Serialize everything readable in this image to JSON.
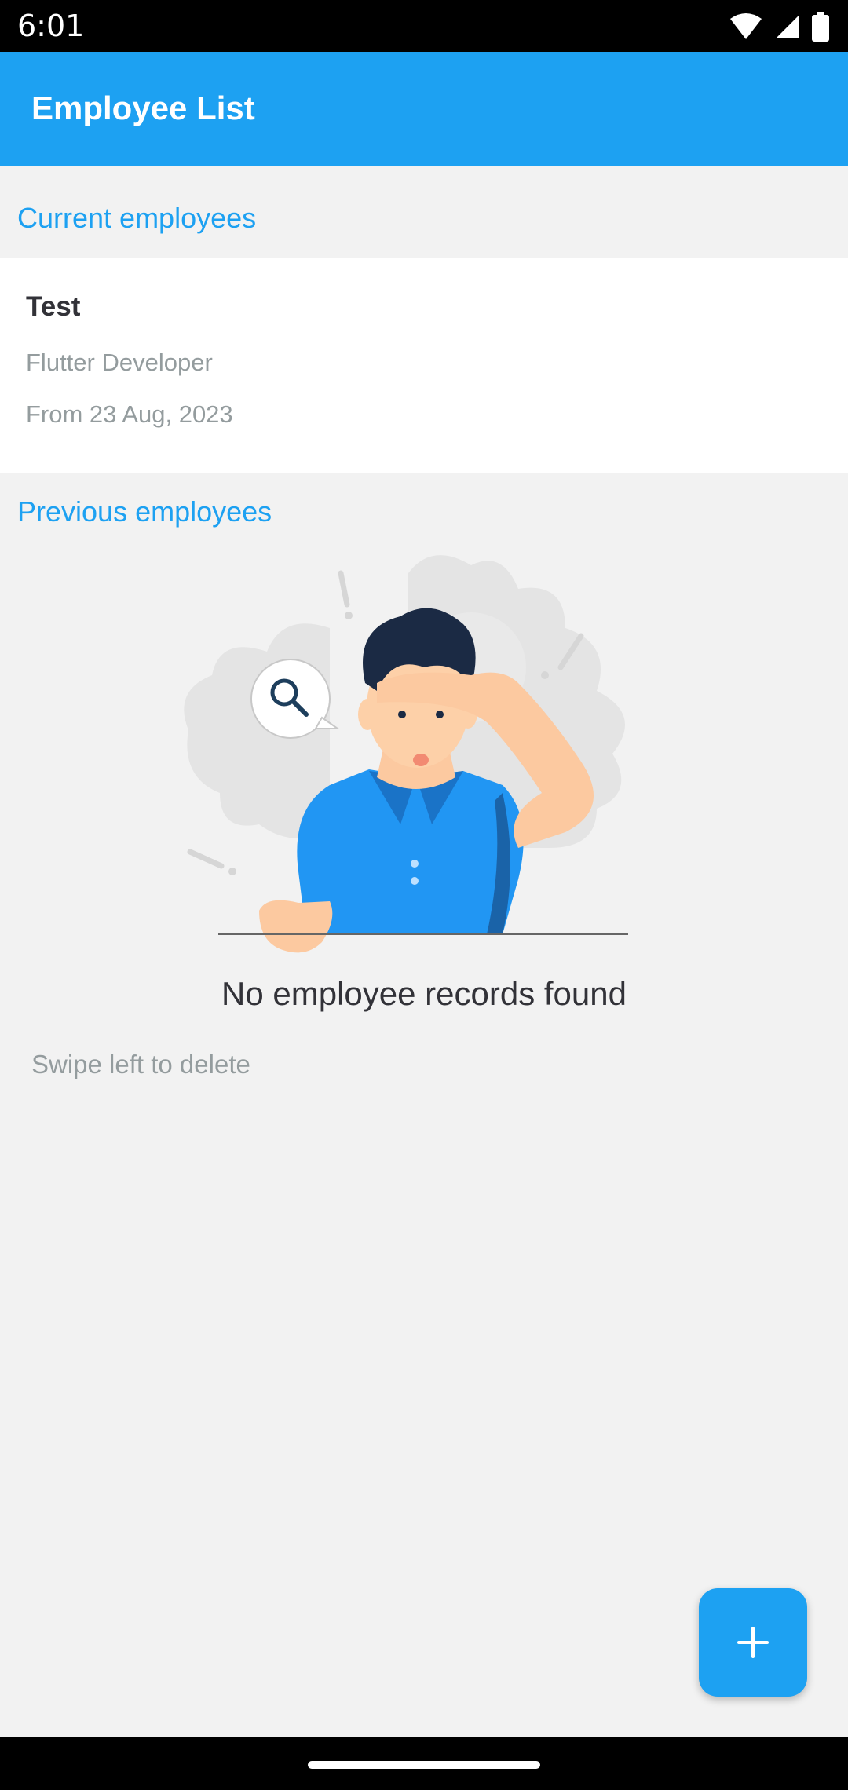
{
  "status_bar": {
    "time": "6:01",
    "icons": [
      "wifi-icon",
      "cellular-signal-icon",
      "battery-icon"
    ]
  },
  "app_bar": {
    "title": "Employee List",
    "color": "#1da1f2"
  },
  "sections": {
    "current": {
      "header": "Current employees",
      "employees": [
        {
          "name": "Test",
          "role": "Flutter Developer",
          "date": "From 23 Aug, 2023"
        }
      ]
    },
    "previous": {
      "header": "Previous employees",
      "empty_message": "No employee records found",
      "illustration": "man-searching-illustration"
    }
  },
  "hint": "Swipe left to delete",
  "fab": {
    "icon": "plus-icon",
    "color": "#1da1f2"
  },
  "colors": {
    "accent": "#1da1f2",
    "background": "#f2f2f2",
    "text_primary": "#323238",
    "text_secondary": "#949c9e"
  }
}
